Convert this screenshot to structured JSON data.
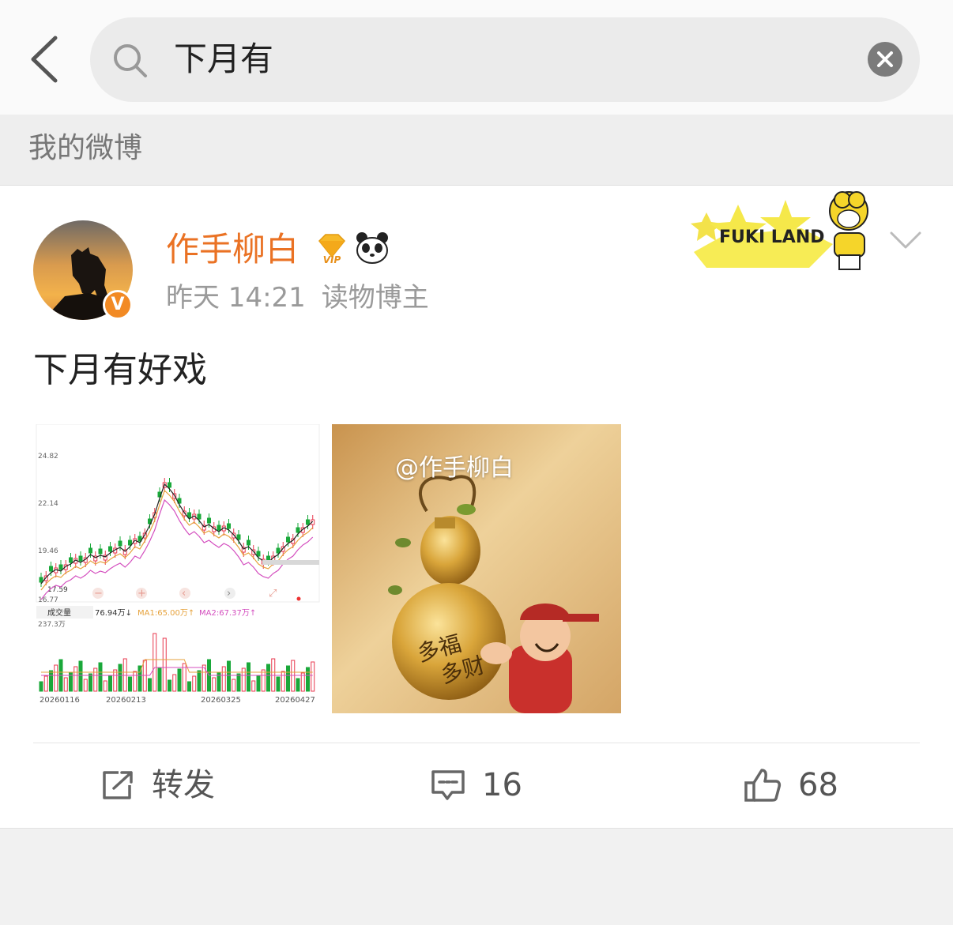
{
  "search": {
    "query": "下月有"
  },
  "section": {
    "title": "我的微博"
  },
  "post": {
    "author": "作手柳白",
    "time": "昨天 14:21",
    "role": "读物博主",
    "text": "下月有好戏",
    "sticker_text": "FUKI LAND",
    "chart": {
      "price_ticks": [
        "24.82",
        "22.14",
        "19.46",
        "16.77"
      ],
      "low_label": "17.59",
      "volume_label": "成交量",
      "volume_value": "76.94万↓",
      "ma1": "MA1:65.00万↑",
      "ma2": "MA2:67.37万↑",
      "volume_max": "237.3万",
      "dates": [
        "20260116",
        "20260213",
        "20260325",
        "20260427"
      ]
    },
    "image2": {
      "watermark": "@作手柳白",
      "gourd_text": [
        "多福",
        "多财"
      ]
    },
    "actions": {
      "repost": "转发",
      "comments": "16",
      "likes": "68"
    }
  },
  "colors": {
    "accent": "#ea7224",
    "vbadge": "#f28a24",
    "bg": "#f1f1f1"
  }
}
